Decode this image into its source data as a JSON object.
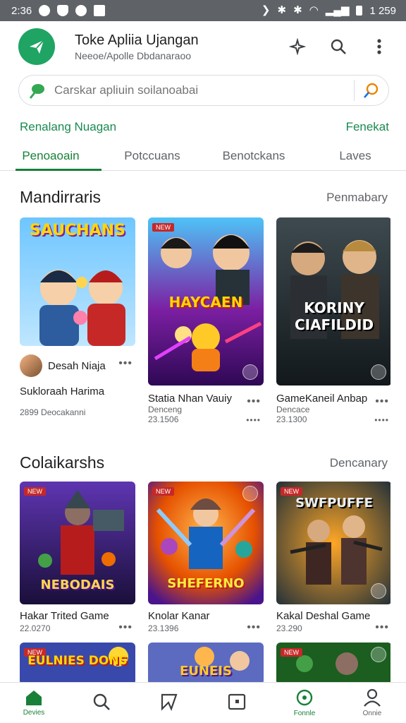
{
  "status": {
    "time": "2:36",
    "clock": "1 259"
  },
  "appbar": {
    "title": "Toke Apliia Ujangan",
    "subtitle": "Neeoe/Apolle Dbdanaraoo"
  },
  "search": {
    "placeholder": "Carskar apliuin soilanoabai"
  },
  "promo": {
    "left": "Renalang Nuagan",
    "right": "Fenekat"
  },
  "tabs": [
    {
      "label": "Penoaoain"
    },
    {
      "label": "Potccuans"
    },
    {
      "label": "Benotckans"
    },
    {
      "label": "Laves"
    }
  ],
  "section1": {
    "title": "Mandirraris",
    "more": "Penmabary",
    "games": [
      {
        "art_title": "SAUCHANS",
        "dev": "Desah Niaja",
        "name": "Sukloraah Harima",
        "meta": "2899 Deocakanni"
      },
      {
        "art_title": "HAYCAEN",
        "name": "Statia Nhan Vauiy",
        "meta": "Denceng",
        "rating": "23.1506"
      },
      {
        "art_title": "KORINY CIAFILDID",
        "name": "GameKaneil Anbap",
        "meta": "Dencace",
        "rating": "23.1300"
      }
    ]
  },
  "section2": {
    "title": "Colaikarshs",
    "more": "Dencanary",
    "games": [
      {
        "art_title": "NEBODAIS",
        "name": "Hakar Trited Game",
        "rating": "22.0270"
      },
      {
        "art_title": "SHEFERNO",
        "name": "Knolar Kanar",
        "rating": "23.1396"
      },
      {
        "art_title": "SWFPUFFE",
        "name": "Kakal Deshal Game",
        "rating": "23.290"
      }
    ]
  },
  "row3": [
    {
      "art_title": "EULNIES DONS"
    },
    {
      "art_title": "EUNEIS"
    },
    {
      "art_title": ""
    }
  ],
  "badge_label": "NEW",
  "bottomnav": [
    {
      "label": "Devies"
    },
    {
      "label": ""
    },
    {
      "label": ""
    },
    {
      "label": ""
    },
    {
      "label": "Fonnle"
    },
    {
      "label": "Onnie"
    }
  ],
  "colors": {
    "accent": "#188038",
    "logo": "#1fa463",
    "statusbar": "#5f6368"
  }
}
